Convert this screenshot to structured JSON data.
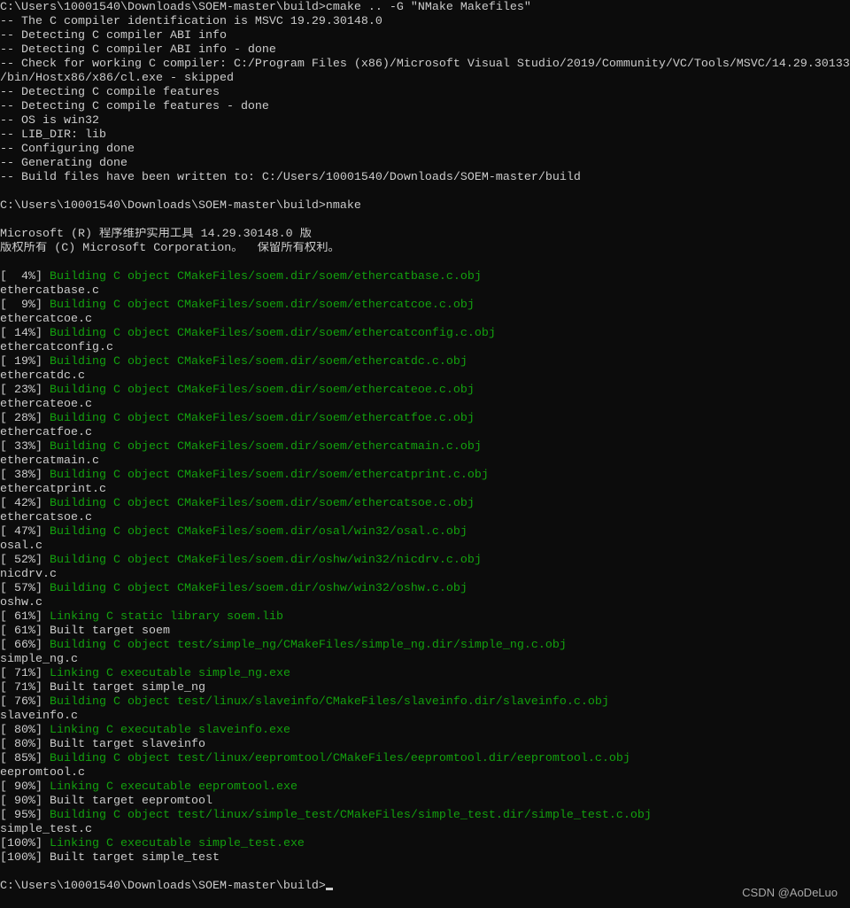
{
  "colors": {
    "background": "#0c0c0c",
    "text": "#cccccc",
    "green": "#13a10e"
  },
  "watermark": "CSDN @AoDeLuo",
  "cursor": true,
  "lines": [
    [
      [
        "C:\\Users\\10001540\\Downloads\\SOEM-master\\build>cmake .. -G \"NMake Makefiles\"",
        "w"
      ]
    ],
    [
      [
        "-- The C compiler identification is MSVC 19.29.30148.0",
        "w"
      ]
    ],
    [
      [
        "-- Detecting C compiler ABI info",
        "w"
      ]
    ],
    [
      [
        "-- Detecting C compiler ABI info - done",
        "w"
      ]
    ],
    [
      [
        "-- Check for working C compiler: C:/Program Files (x86)/Microsoft Visual Studio/2019/Community/VC/Tools/MSVC/14.29.30133",
        "w"
      ]
    ],
    [
      [
        "/bin/Hostx86/x86/cl.exe - skipped",
        "w"
      ]
    ],
    [
      [
        "-- Detecting C compile features",
        "w"
      ]
    ],
    [
      [
        "-- Detecting C compile features - done",
        "w"
      ]
    ],
    [
      [
        "-- OS is win32",
        "w"
      ]
    ],
    [
      [
        "-- LIB_DIR: lib",
        "w"
      ]
    ],
    [
      [
        "-- Configuring done",
        "w"
      ]
    ],
    [
      [
        "-- Generating done",
        "w"
      ]
    ],
    [
      [
        "-- Build files have been written to: C:/Users/10001540/Downloads/SOEM-master/build",
        "w"
      ]
    ],
    [],
    [
      [
        "C:\\Users\\10001540\\Downloads\\SOEM-master\\build>nmake",
        "w"
      ]
    ],
    [],
    [
      [
        "Microsoft (R) 程序维护实用工具 14.29.30148.0 版",
        "w"
      ]
    ],
    [
      [
        "版权所有 (C) Microsoft Corporation。  保留所有权利。",
        "w"
      ]
    ],
    [],
    [
      [
        "[  4%] ",
        "w"
      ],
      [
        "Building C object CMakeFiles/soem.dir/soem/ethercatbase.c.obj",
        "g"
      ]
    ],
    [
      [
        "ethercatbase.c",
        "w"
      ]
    ],
    [
      [
        "[  9%] ",
        "w"
      ],
      [
        "Building C object CMakeFiles/soem.dir/soem/ethercatcoe.c.obj",
        "g"
      ]
    ],
    [
      [
        "ethercatcoe.c",
        "w"
      ]
    ],
    [
      [
        "[ 14%] ",
        "w"
      ],
      [
        "Building C object CMakeFiles/soem.dir/soem/ethercatconfig.c.obj",
        "g"
      ]
    ],
    [
      [
        "ethercatconfig.c",
        "w"
      ]
    ],
    [
      [
        "[ 19%] ",
        "w"
      ],
      [
        "Building C object CMakeFiles/soem.dir/soem/ethercatdc.c.obj",
        "g"
      ]
    ],
    [
      [
        "ethercatdc.c",
        "w"
      ]
    ],
    [
      [
        "[ 23%] ",
        "w"
      ],
      [
        "Building C object CMakeFiles/soem.dir/soem/ethercateoe.c.obj",
        "g"
      ]
    ],
    [
      [
        "ethercateoe.c",
        "w"
      ]
    ],
    [
      [
        "[ 28%] ",
        "w"
      ],
      [
        "Building C object CMakeFiles/soem.dir/soem/ethercatfoe.c.obj",
        "g"
      ]
    ],
    [
      [
        "ethercatfoe.c",
        "w"
      ]
    ],
    [
      [
        "[ 33%] ",
        "w"
      ],
      [
        "Building C object CMakeFiles/soem.dir/soem/ethercatmain.c.obj",
        "g"
      ]
    ],
    [
      [
        "ethercatmain.c",
        "w"
      ]
    ],
    [
      [
        "[ 38%] ",
        "w"
      ],
      [
        "Building C object CMakeFiles/soem.dir/soem/ethercatprint.c.obj",
        "g"
      ]
    ],
    [
      [
        "ethercatprint.c",
        "w"
      ]
    ],
    [
      [
        "[ 42%] ",
        "w"
      ],
      [
        "Building C object CMakeFiles/soem.dir/soem/ethercatsoe.c.obj",
        "g"
      ]
    ],
    [
      [
        "ethercatsoe.c",
        "w"
      ]
    ],
    [
      [
        "[ 47%] ",
        "w"
      ],
      [
        "Building C object CMakeFiles/soem.dir/osal/win32/osal.c.obj",
        "g"
      ]
    ],
    [
      [
        "osal.c",
        "w"
      ]
    ],
    [
      [
        "[ 52%] ",
        "w"
      ],
      [
        "Building C object CMakeFiles/soem.dir/oshw/win32/nicdrv.c.obj",
        "g"
      ]
    ],
    [
      [
        "nicdrv.c",
        "w"
      ]
    ],
    [
      [
        "[ 57%] ",
        "w"
      ],
      [
        "Building C object CMakeFiles/soem.dir/oshw/win32/oshw.c.obj",
        "g"
      ]
    ],
    [
      [
        "oshw.c",
        "w"
      ]
    ],
    [
      [
        "[ 61%] ",
        "w"
      ],
      [
        "Linking C static library soem.lib",
        "g"
      ]
    ],
    [
      [
        "[ 61%] Built target soem",
        "w"
      ]
    ],
    [
      [
        "[ 66%] ",
        "w"
      ],
      [
        "Building C object test/simple_ng/CMakeFiles/simple_ng.dir/simple_ng.c.obj",
        "g"
      ]
    ],
    [
      [
        "simple_ng.c",
        "w"
      ]
    ],
    [
      [
        "[ 71%] ",
        "w"
      ],
      [
        "Linking C executable simple_ng.exe",
        "g"
      ]
    ],
    [
      [
        "[ 71%] Built target simple_ng",
        "w"
      ]
    ],
    [
      [
        "[ 76%] ",
        "w"
      ],
      [
        "Building C object test/linux/slaveinfo/CMakeFiles/slaveinfo.dir/slaveinfo.c.obj",
        "g"
      ]
    ],
    [
      [
        "slaveinfo.c",
        "w"
      ]
    ],
    [
      [
        "[ 80%] ",
        "w"
      ],
      [
        "Linking C executable slaveinfo.exe",
        "g"
      ]
    ],
    [
      [
        "[ 80%] Built target slaveinfo",
        "w"
      ]
    ],
    [
      [
        "[ 85%] ",
        "w"
      ],
      [
        "Building C object test/linux/eepromtool/CMakeFiles/eepromtool.dir/eepromtool.c.obj",
        "g"
      ]
    ],
    [
      [
        "eepromtool.c",
        "w"
      ]
    ],
    [
      [
        "[ 90%] ",
        "w"
      ],
      [
        "Linking C executable eepromtool.exe",
        "g"
      ]
    ],
    [
      [
        "[ 90%] Built target eepromtool",
        "w"
      ]
    ],
    [
      [
        "[ 95%] ",
        "w"
      ],
      [
        "Building C object test/linux/simple_test/CMakeFiles/simple_test.dir/simple_test.c.obj",
        "g"
      ]
    ],
    [
      [
        "simple_test.c",
        "w"
      ]
    ],
    [
      [
        "[100%] ",
        "w"
      ],
      [
        "Linking C executable simple_test.exe",
        "g"
      ]
    ],
    [
      [
        "[100%] Built target simple_test",
        "w"
      ]
    ],
    [],
    [
      [
        "C:\\Users\\10001540\\Downloads\\SOEM-master\\build>",
        "w"
      ]
    ]
  ]
}
